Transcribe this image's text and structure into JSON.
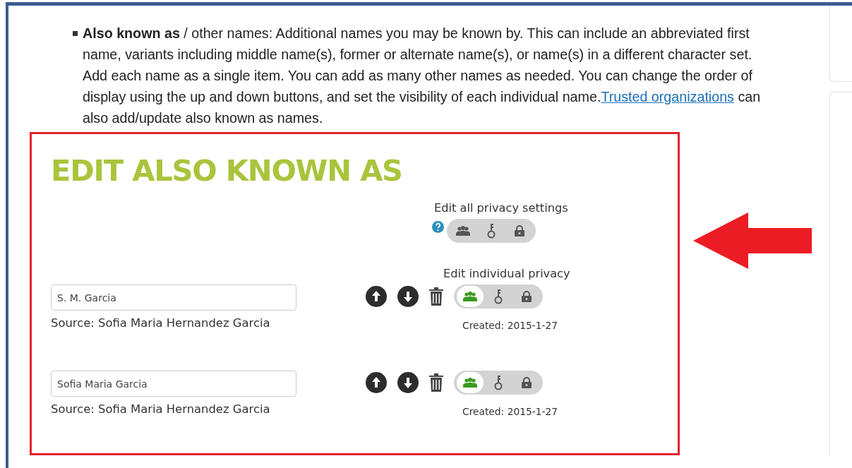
{
  "intro": {
    "text": "**Also known as** / other names: Additional names you may be known by. This can include an abbreviated first name, variants including middle name(s), former or alternate name(s), or name(s) in a different character set. Add each name as a single item. You can add as many other names as needed. You can change the order of display using the up and down buttons, and set the visibility of each individual name.",
    "link": "Trusted organizations",
    "text_after": " can also add/update also known as names."
  },
  "panel": {
    "title": "EDIT ALSO KNOWN AS",
    "all_privacy": {
      "label": "Edit all privacy settings",
      "options": [
        {
          "kind": "everyone",
          "selected": false
        },
        {
          "kind": "trusted",
          "selected": false
        },
        {
          "kind": "private",
          "selected": false
        }
      ]
    },
    "individual_label": "Edit individual privacy",
    "names": [
      {
        "value": "S. M. Garcia",
        "source": "Source: Sofia Maria Hernandez Garcia",
        "created": "Created: 2015-1-27",
        "privacy": [
          {
            "kind": "everyone",
            "selected": true
          },
          {
            "kind": "trusted",
            "selected": false
          },
          {
            "kind": "private",
            "selected": false
          }
        ]
      },
      {
        "value": "Sofia Maria Garcia",
        "source": "Source: Sofia Maria Hernandez Garcia",
        "created": "Created: 2015-1-27",
        "privacy": [
          {
            "kind": "everyone",
            "selected": true
          },
          {
            "kind": "trusted",
            "selected": false
          },
          {
            "kind": "private",
            "selected": false
          }
        ]
      }
    ]
  }
}
